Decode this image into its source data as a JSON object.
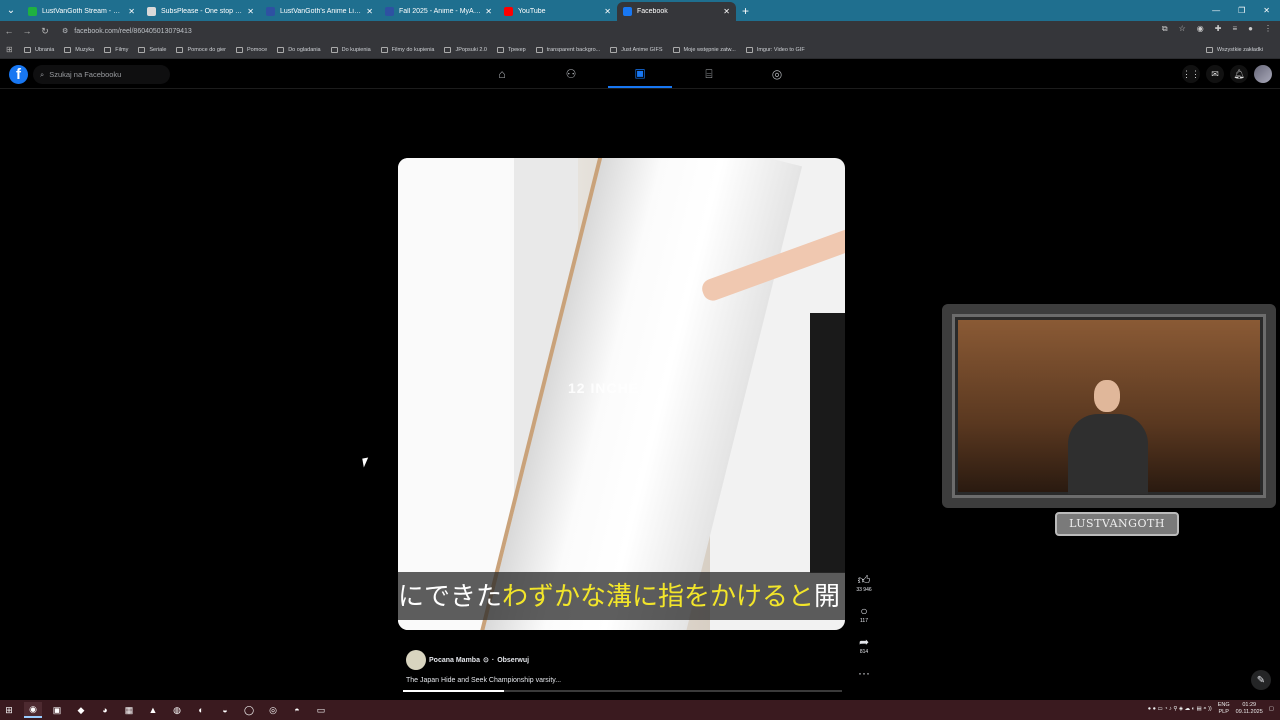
{
  "browser": {
    "tabs": [
      {
        "title": "LustVanGoth Stream - Watch Li...",
        "color": "#1fb141",
        "active": false
      },
      {
        "title": "SubsPlease - One stop shop fo...",
        "color": "#d9d9d9",
        "active": false
      },
      {
        "title": "LustVanGoth's Anime List - My...",
        "color": "#2e51a2",
        "active": false
      },
      {
        "title": "Fall 2025 - Anime - MyAnimeLi...",
        "color": "#2e51a2",
        "active": false
      },
      {
        "title": "YouTube",
        "color": "#ff0000",
        "active": false
      },
      {
        "title": "Facebook",
        "color": "#1877f2",
        "active": true
      }
    ],
    "url": "facebook.com/reel/860405013079413",
    "bookmarks": [
      "Ubrania",
      "Muzyka",
      "Filmy",
      "Seriale",
      "Pomoce do gier",
      "Pomoce",
      "Do ogladania",
      "Do kupienia",
      "Filmy do kupienia",
      "JPopsuki 2.0",
      "Трекер",
      "transparent backgro...",
      "Just Anime GIFS",
      "Moje wstępnie zatw...",
      "Imgur: Video to GIF"
    ],
    "bookmarks_right": "Wszystkie zakładki"
  },
  "facebook": {
    "logo": "f",
    "search_placeholder": "Szukaj na Facebooku",
    "nav_icons": [
      "home-icon",
      "friends-icon",
      "reels-icon",
      "marketplace-icon",
      "groups-icon"
    ],
    "active_nav": "reels-icon"
  },
  "reel": {
    "overlay_text": "12 INCHE",
    "subtitle_white_1": "にできた",
    "subtitle_yellow": "わずかな溝に指をかけると",
    "subtitle_white_2": "開",
    "likes": "33 946",
    "comments": "117",
    "shares": "814",
    "author": "Pocana Mamba",
    "follow": "Obserwuj",
    "separator": "·",
    "caption": "The Japan Hide and Seek Championship varsity...",
    "progress_fraction": 0.23
  },
  "webcam": {
    "label": "LUSTVANGOTH"
  },
  "taskbar": {
    "lang_top": "ENG",
    "lang_bottom": "PLP",
    "time": "01:29",
    "date": "09.11.2025"
  }
}
